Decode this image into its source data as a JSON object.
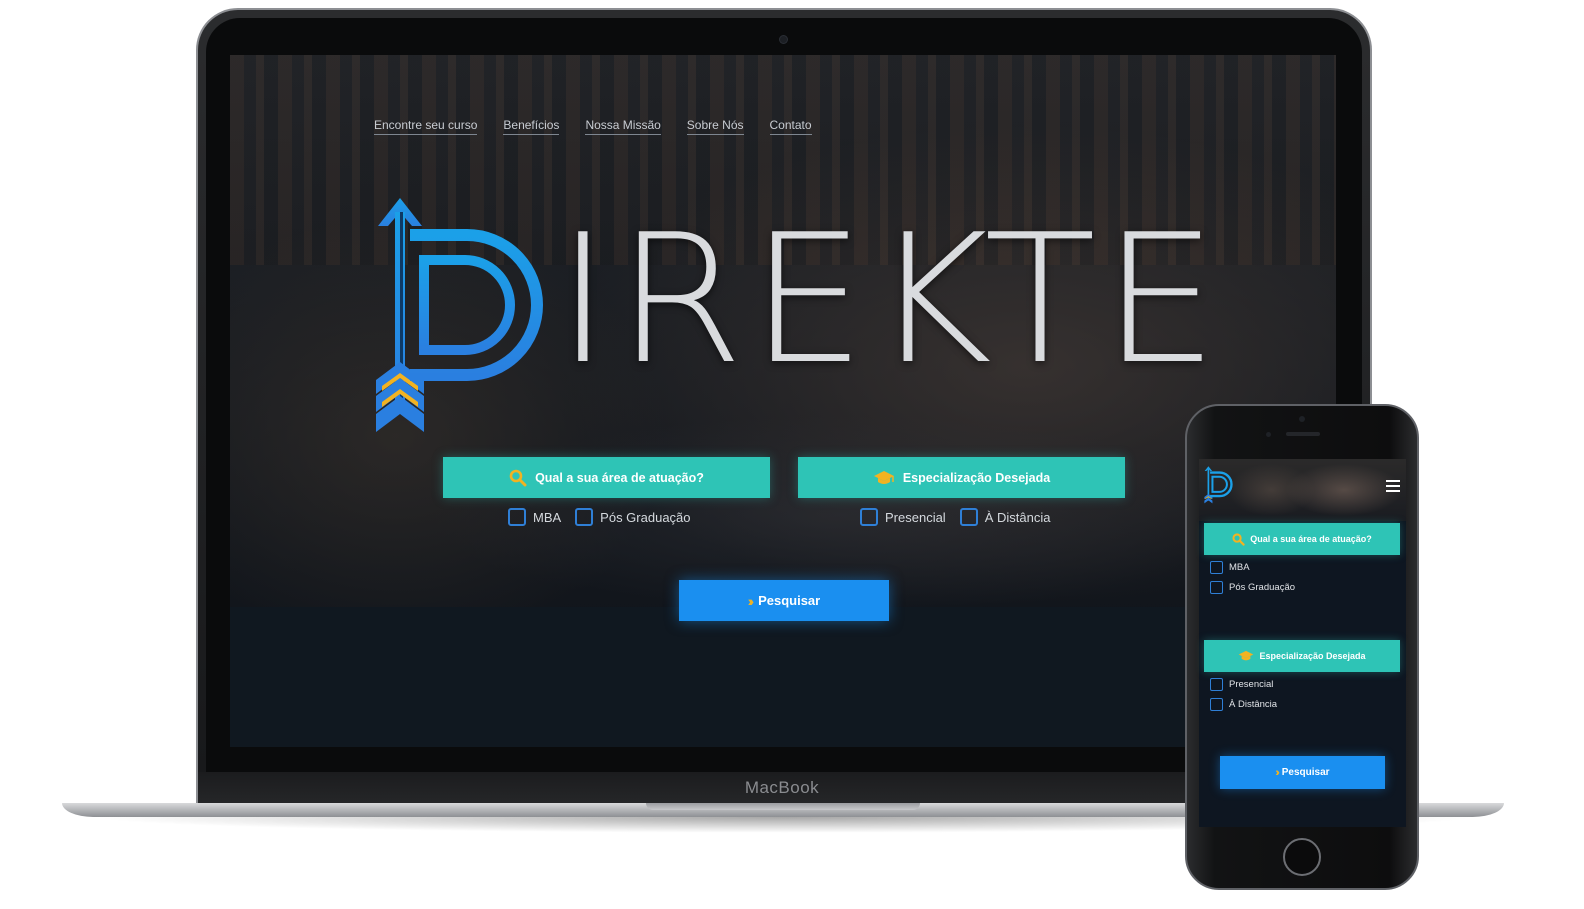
{
  "device_labels": {
    "laptop_brand": "MacBook"
  },
  "desktop": {
    "nav": [
      {
        "label": "Encontre seu curso"
      },
      {
        "label": "Benefícios"
      },
      {
        "label": "Nossa Missão"
      },
      {
        "label": "Sobre Nós"
      },
      {
        "label": "Contato"
      }
    ],
    "logo_text": "IREKTE",
    "area_button": "Qual a sua área de atuação?",
    "spec_button": "Especialização Desejada",
    "area_options": [
      {
        "label": "MBA"
      },
      {
        "label": "Pós Graduação"
      }
    ],
    "spec_options": [
      {
        "label": "Presencial"
      },
      {
        "label": "À Distância"
      }
    ],
    "search_button": "Pesquisar"
  },
  "mobile": {
    "area_button": "Qual a sua área de atuação?",
    "spec_button": "Especialização Desejada",
    "area_options": [
      {
        "label": "MBA"
      },
      {
        "label": "Pós Graduação"
      }
    ],
    "spec_options": [
      {
        "label": "Presencial"
      },
      {
        "label": "À Distância"
      }
    ],
    "search_button": "Pesquisar"
  },
  "colors": {
    "teal_accent": "#2ec4b6",
    "blue_accent": "#1a8ff0",
    "logo_blue": "#1fa3f0",
    "chevron_yellow": "#f2b321",
    "checkbox_border": "#2f7fd6"
  },
  "icons": {
    "area_icon": "search-icon",
    "spec_icon": "graduation-cap-icon",
    "search_icon": "double-chevron-right-icon",
    "menu_icon": "hamburger-menu-icon"
  }
}
